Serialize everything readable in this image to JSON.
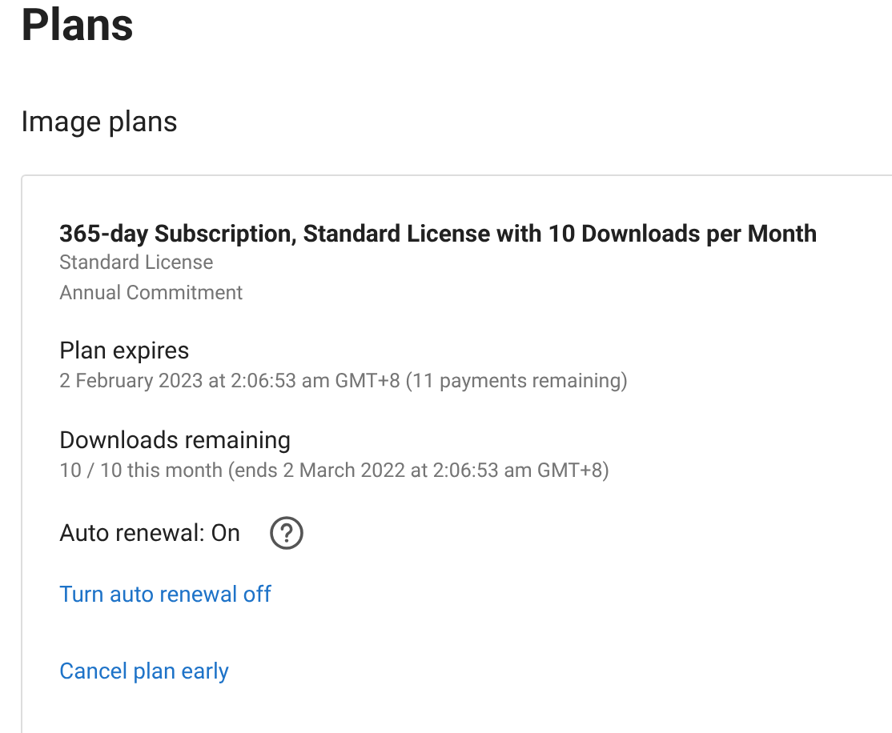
{
  "page_title": "Plans",
  "section_title": "Image plans",
  "plan": {
    "name": "365-day Subscription, Standard License with 10 Downloads per Month",
    "details": [
      "Standard License",
      "Annual Commitment"
    ]
  },
  "info": [
    {
      "label": "Plan expires",
      "value": "2 February 2023 at 2:06:53 am GMT+8 (11 payments remaining)"
    },
    {
      "label": "Downloads remaining",
      "value": "10 / 10 this month (ends 2 March 2022 at 2:06:53 am GMT+8)"
    }
  ],
  "auto_renewal": {
    "label": "Auto renewal: On"
  },
  "links": [
    "Turn auto renewal off",
    "Cancel plan early"
  ]
}
